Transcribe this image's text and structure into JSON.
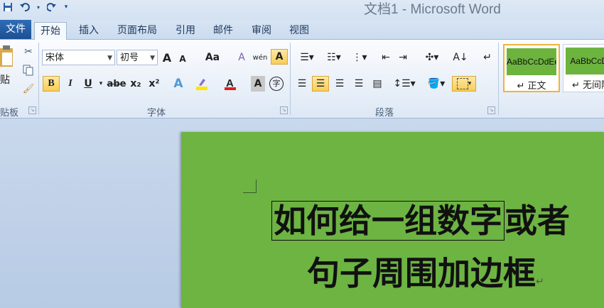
{
  "window": {
    "title": "文档1 - Microsoft Word"
  },
  "quick_access": [
    {
      "icon": "save-icon"
    },
    {
      "icon": "undo-icon"
    },
    {
      "icon": "redo-icon"
    },
    {
      "icon": "customize-dropdown-icon"
    }
  ],
  "tabs": {
    "file": "文件",
    "home": "开始",
    "insert": "插入",
    "page_layout": "页面布局",
    "references": "引用",
    "mailings": "邮件",
    "review": "审阅",
    "view": "视图"
  },
  "clipboard": {
    "paste_label": "贴",
    "group_label": "贴板"
  },
  "font": {
    "name": "宋体",
    "size": "初号",
    "group_label": "字体",
    "bold": "B",
    "italic": "I",
    "underline": "U",
    "strike": "abe",
    "subscript": "x₂",
    "superscript": "x²",
    "grow": "A",
    "shrink": "A",
    "case": "Aa",
    "clear": "A",
    "pinyin": "wén",
    "char_border": "A",
    "char_shading": "A",
    "enclose": "字"
  },
  "paragraph": {
    "group_label": "段落"
  },
  "styles": [
    {
      "preview": "AaBbCcDdEe",
      "name": "↵ 正文"
    },
    {
      "preview": "AaBbCcDd",
      "name": "↵ 无间隔"
    }
  ],
  "document": {
    "boxed_text": "如何给一组数字",
    "after_box": "或者",
    "line2": "句子周围加边框",
    "pilcrow": "↵"
  },
  "colors": {
    "page": "#6db443",
    "file_tab": "#1d4f94",
    "highlight_button": "#f8cd57"
  }
}
